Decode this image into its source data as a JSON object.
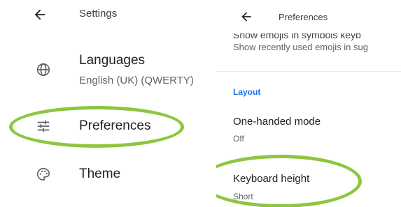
{
  "left_screen": {
    "header": {
      "back_icon": "arrow-left-icon",
      "title": "Settings"
    },
    "items": [
      {
        "icon": "globe-icon",
        "title": "Languages",
        "subtitle": "English (UK) (QWERTY)"
      },
      {
        "icon": "sliders-icon",
        "title": "Preferences"
      },
      {
        "icon": "palette-icon",
        "title": "Theme"
      }
    ]
  },
  "right_screen": {
    "header": {
      "back_icon": "arrow-left-icon",
      "title": "Preferences"
    },
    "clipped_row": {
      "title": "Show emojis in symbols keyb",
      "subtitle": "Show recently used emojis in sug"
    },
    "section_label": "Layout",
    "items": [
      {
        "title": "One-handed mode",
        "subtitle": "Off"
      },
      {
        "title": "Keyboard height",
        "subtitle": "Short"
      }
    ]
  },
  "colors": {
    "highlight": "#8dc63f",
    "section_accent": "#1a73e8",
    "icon": "#5f6368"
  }
}
